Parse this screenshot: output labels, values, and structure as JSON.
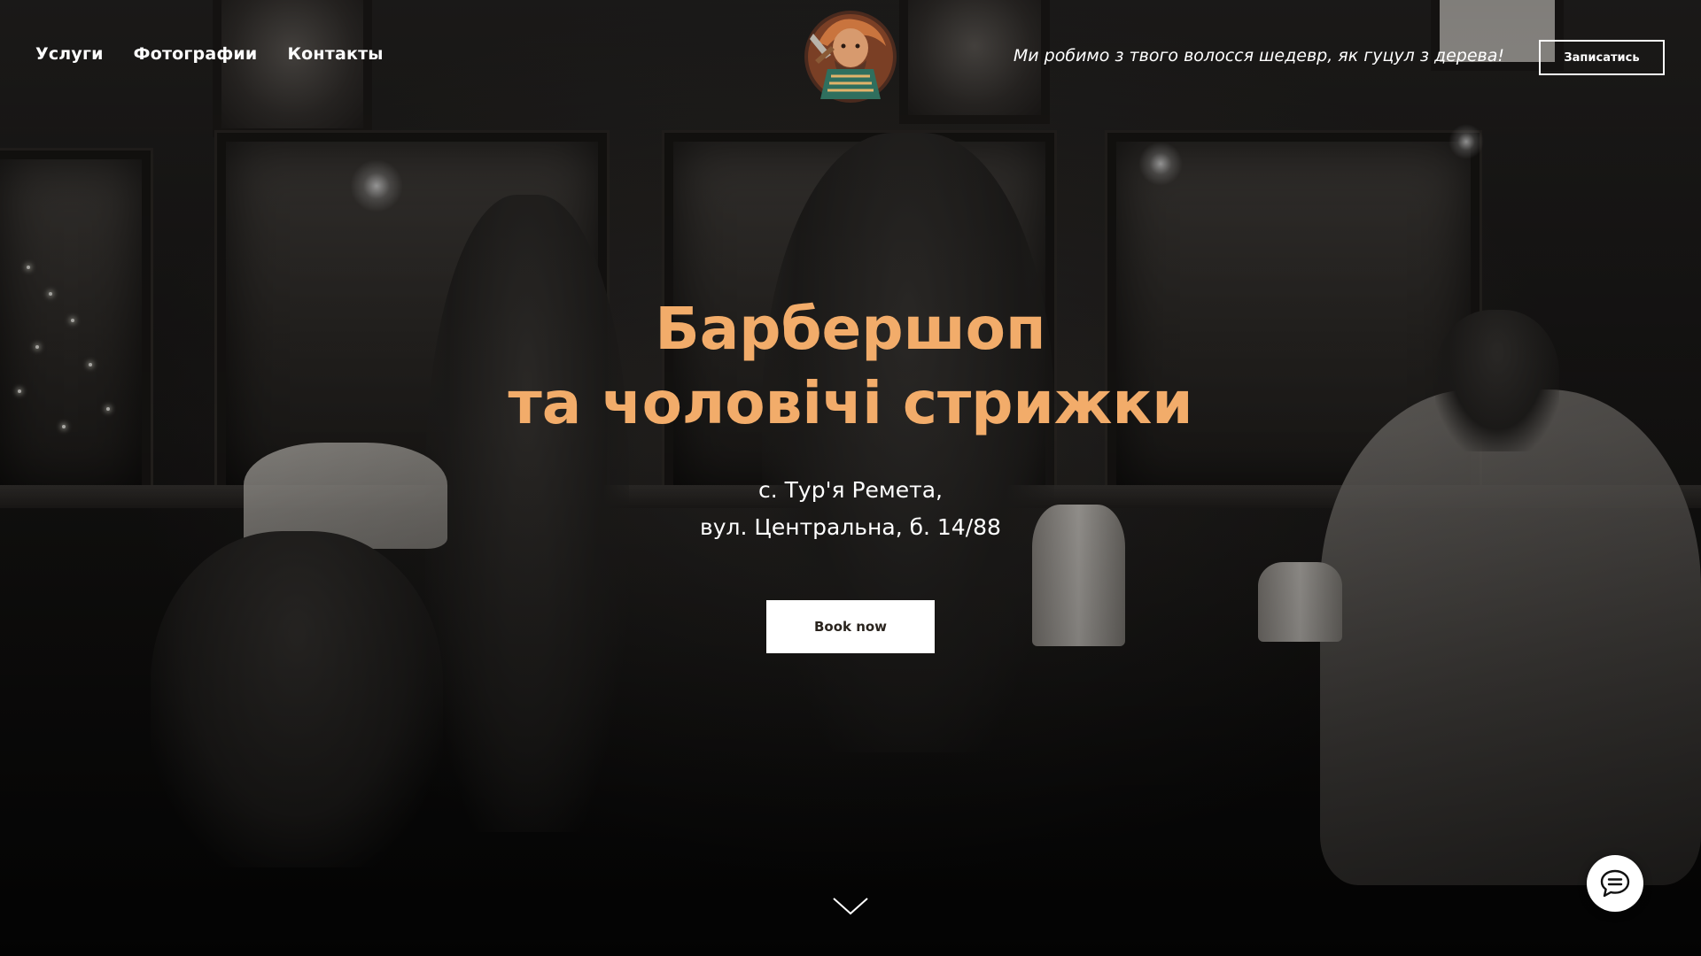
{
  "nav": {
    "items": [
      {
        "label": "Услуги"
      },
      {
        "label": "Фотографии"
      },
      {
        "label": "Контакты"
      }
    ]
  },
  "header": {
    "logo_icon": "hutsul-barber-logo-icon",
    "tagline": "Ми робимо з твого волосся шедевр, як гуцул з дерева!",
    "cta_label": "Записатись"
  },
  "hero": {
    "title_line1": "Барбершоп",
    "title_line2": "та чоловічі стрижки",
    "address_line1": "с. Тур'я Ремета,",
    "address_line2": "вул. Центральна, б. 14/88",
    "book_label": "Book now",
    "scroll_icon": "chevron-down-icon"
  },
  "chat": {
    "icon": "chat-bubble-icon"
  },
  "colors": {
    "accent": "#f2ac6a",
    "text": "#ffffff",
    "button_bg": "#ffffff",
    "button_text": "#2a241e"
  }
}
